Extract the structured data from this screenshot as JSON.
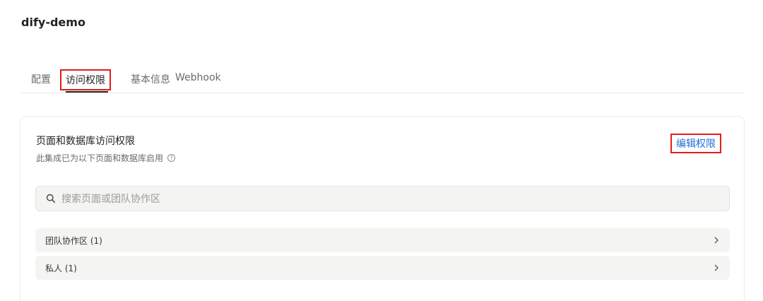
{
  "app": {
    "title": "dify-demo"
  },
  "tabs": [
    {
      "label": "配置"
    },
    {
      "label": "访问权限"
    },
    {
      "label": "基本信息"
    },
    {
      "label": "Webhook"
    }
  ],
  "access": {
    "title": "页面和数据库访问权限",
    "subtitle": "此集成已为以下页面和数据库启用",
    "help_icon_glyph": "?",
    "edit_label": "编辑权限",
    "search": {
      "placeholder": "搜索页面或团队协作区"
    },
    "groups": [
      {
        "label": "团队协作区 (1)"
      },
      {
        "label": "私人 (1)"
      }
    ]
  },
  "colors": {
    "highlight_border": "#e11d1d",
    "link": "#1f6fd6"
  },
  "icons": [
    "search-icon",
    "help-circle-icon",
    "chevron-right-icon"
  ]
}
